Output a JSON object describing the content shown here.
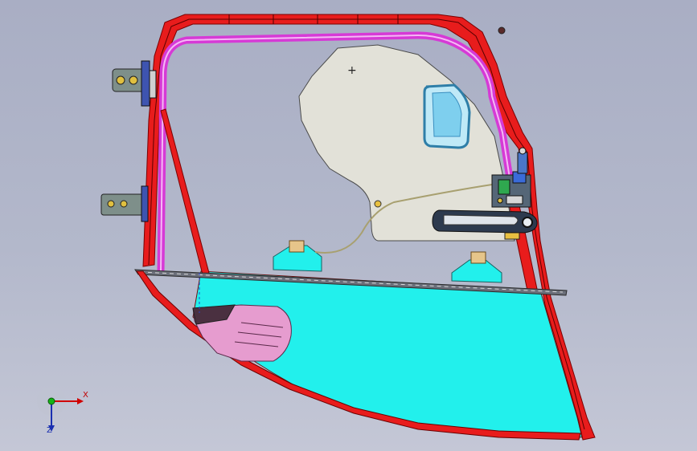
{
  "viewport": {
    "background_top": "#a9aec4",
    "background_bottom": "#c4c7d6"
  },
  "model": {
    "frame_color": "#e01818",
    "seal_color": "#d63ad6",
    "panel_color": "#e2e1d8",
    "glass_color": "#22f0ec",
    "speaker_color": "#e69ccf",
    "dark_color": "#2a2a2a"
  },
  "triad": {
    "x_label": "X",
    "z_label": "Z",
    "x_color": "#d00000",
    "z_color": "#1a2fb0",
    "y_color": "#14b414"
  }
}
